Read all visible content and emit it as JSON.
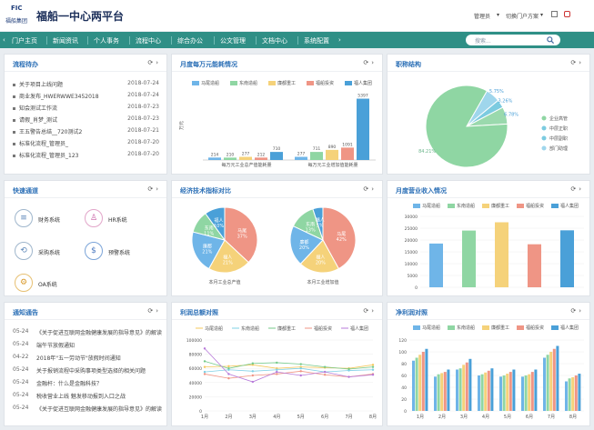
{
  "header": {
    "logo_text": "FIC",
    "logo_sub": "福船集团",
    "title": "福船一中心两平台",
    "user": "管理员",
    "switch": "切换门户方案"
  },
  "nav": {
    "items": [
      "门户主页",
      "新闻资讯",
      "个人事务",
      "流程中心",
      "综合办公",
      "公文管理",
      "文档中心",
      "系统配置"
    ],
    "search_placeholder": "搜索..."
  },
  "colors": {
    "nav": "#2f8f86",
    "title": "#2b6fb6",
    "s1": "#6fb5e8",
    "s2": "#8fd6a3",
    "s3": "#f5d27a",
    "s4": "#ef9585",
    "s5": "#4aa0d8"
  },
  "workflow": {
    "title": "流程待办",
    "items": [
      {
        "text": "关于项目上线问题",
        "date": "2018-07-24"
      },
      {
        "text": "商业发布_HWERWWE3452018",
        "date": "2018-07-24"
      },
      {
        "text": "知会测试工作流",
        "date": "2018-07-23"
      },
      {
        "text": "请假_肖梦_测试",
        "date": "2018-07-23"
      },
      {
        "text": "王五警告总结__720测试2",
        "date": "2018-07-21"
      },
      {
        "text": "标准化流程_管理员_",
        "date": "2018-07-20"
      },
      {
        "text": "标准化流程_管理员_123",
        "date": "2018-07-20"
      }
    ]
  },
  "monthly": {
    "title": "月度每万元能耗情况",
    "categories": [
      "每万元工业总产值能耗量",
      "每万元工业增加值能耗量"
    ],
    "series": [
      {
        "name": "马尾造船",
        "values": [
          214,
          277
        ]
      },
      {
        "name": "东南造船",
        "values": [
          210,
          711
        ]
      },
      {
        "name": "廉都重工",
        "values": [
          277,
          890
        ]
      },
      {
        "name": "福船投资",
        "values": [
          212,
          1091
        ]
      },
      {
        "name": "福人集团",
        "values": [
          710,
          5397
        ]
      }
    ],
    "ylabel": "万元",
    "ymax": 6000
  },
  "staff": {
    "title": "职称结构",
    "labels": [
      "企业高管",
      "中层正职",
      "中层副职",
      "部门助理"
    ],
    "values": [
      5.75,
      3.26,
      6.78,
      84.21
    ],
    "texts": [
      "5.75%",
      "3.26%",
      "6.78%",
      "84.21%"
    ]
  },
  "quick": {
    "title": "快速通道",
    "items": [
      "财务系统",
      "HR系统",
      "采购系统",
      "预警系统",
      "OA系统"
    ]
  },
  "econ": {
    "title": "经济技术指标对比",
    "pie_labels": [
      "本月工业总产值",
      "本月工业增加值"
    ],
    "pies": [
      {
        "labels": [
          "马尾",
          "福人",
          "廉都",
          "东南",
          "福人"
        ],
        "values": [
          37,
          21,
          21,
          11,
          10
        ],
        "texts": [
          "37%",
          "21%",
          "21%",
          "11%",
          "10%"
        ]
      },
      {
        "labels": [
          "马尾",
          "福人",
          "廉都",
          "东南",
          "福人"
        ],
        "values": [
          42,
          20,
          20,
          13,
          5
        ],
        "texts": [
          "42%",
          "20%",
          "20%",
          "13%",
          "5%"
        ]
      }
    ]
  },
  "revenue": {
    "title": "月度营业收入情况",
    "series": [
      {
        "name": "马尾造船",
        "value": 18500
      },
      {
        "name": "东南造船",
        "value": 24000
      },
      {
        "name": "廉都重工",
        "value": 27500
      },
      {
        "name": "福船投资",
        "value": 18200
      },
      {
        "name": "福人集团",
        "value": 24100
      }
    ],
    "yticks": [
      "0",
      "5000",
      "10000",
      "15000",
      "20000",
      "25000",
      "30000"
    ],
    "ymax": 30000
  },
  "notices": {
    "title": "通知通告",
    "items": [
      {
        "date": "05-24",
        "text": "《关于促进互联网金融健康发展的指导意见》的解读"
      },
      {
        "date": "05-24",
        "text": "端午节放假通知"
      },
      {
        "date": "04-22",
        "text": "2018年\"五一劳动节\"放假时间通知"
      },
      {
        "date": "05-24",
        "text": "关于报销流程中采购事项类型选择的相关问题"
      },
      {
        "date": "05-24",
        "text": "金融杆：什么是金融科技？"
      },
      {
        "date": "05-24",
        "text": "税收营业上线 魅发移动报到入口之战"
      },
      {
        "date": "05-24",
        "text": "《关于促进互联网金融健康发展的指导意见》的解读"
      }
    ]
  },
  "profit": {
    "title": "利润总额对照",
    "months": [
      "1月",
      "2月",
      "3月",
      "4月",
      "5月",
      "6月",
      "7月",
      "8月"
    ],
    "yticks": [
      "0",
      "20000",
      "40000",
      "60000",
      "80000",
      "100000"
    ],
    "ymax": 100000,
    "series": [
      {
        "name": "马尾造船",
        "values": [
          62000,
          63000,
          65000,
          60000,
          62000,
          61000,
          60000,
          65000
        ]
      },
      {
        "name": "东南造船",
        "values": [
          55000,
          58000,
          56000,
          58000,
          60000,
          55000,
          57000,
          58000
        ]
      },
      {
        "name": "廉都重工",
        "values": [
          70000,
          60000,
          67000,
          68000,
          66000,
          62000,
          59000,
          62000
        ]
      },
      {
        "name": "福船投资",
        "values": [
          52000,
          46000,
          50000,
          52000,
          56000,
          51000,
          48000,
          52000
        ]
      },
      {
        "name": "福人集团",
        "values": [
          88000,
          52000,
          41000,
          55000,
          50000,
          55000,
          48000,
          51000
        ]
      }
    ]
  },
  "net": {
    "title": "净利润对照",
    "months": [
      "1月",
      "2月",
      "3月",
      "4月",
      "5月",
      "6月",
      "7月",
      "8月"
    ],
    "yticks": [
      "0",
      "20",
      "40",
      "60",
      "80",
      "100",
      "120"
    ],
    "ymax": 120,
    "series": [
      {
        "name": "马尾造船",
        "values": [
          85,
          58,
          70,
          60,
          58,
          58,
          90,
          50
        ]
      },
      {
        "name": "东南造船",
        "values": [
          90,
          62,
          72,
          62,
          60,
          60,
          95,
          55
        ]
      },
      {
        "name": "廉都重工",
        "values": [
          95,
          64,
          78,
          65,
          63,
          62,
          100,
          57
        ]
      },
      {
        "name": "福船投资",
        "values": [
          100,
          66,
          82,
          68,
          66,
          66,
          105,
          60
        ]
      },
      {
        "name": "福人集团",
        "values": [
          105,
          70,
          88,
          72,
          70,
          70,
          110,
          63
        ]
      }
    ]
  }
}
